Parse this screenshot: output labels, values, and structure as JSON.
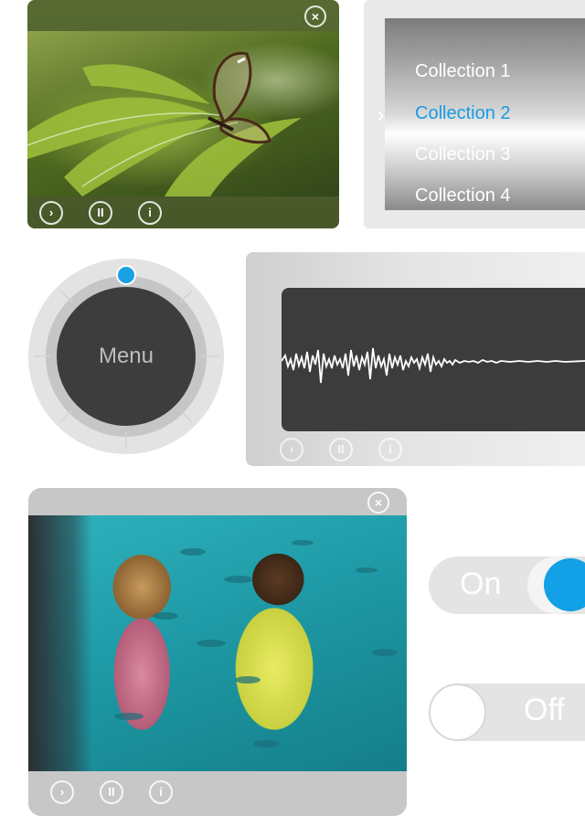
{
  "media_player_top": {
    "controls": {
      "next": "›",
      "pause": "II",
      "info": "i",
      "close": "×"
    }
  },
  "collections": {
    "items": [
      {
        "label": "Collection 1"
      },
      {
        "label": "Collection 2"
      },
      {
        "label": "Collection 3"
      },
      {
        "label": "Collection 4"
      }
    ],
    "active_index": 1,
    "chevron": "›",
    "accent_color": "#1a9be0"
  },
  "dial": {
    "label": "Menu",
    "indicator_color": "#1aa0e4"
  },
  "audio_player": {
    "controls": {
      "next": "›",
      "pause": "II",
      "info": "i"
    }
  },
  "media_player_bottom": {
    "controls": {
      "next": "›",
      "pause": "II",
      "info": "i",
      "close": "×"
    }
  },
  "toggle_on": {
    "label": "On",
    "color": "#12a0e6"
  },
  "toggle_off": {
    "label": "Off"
  }
}
